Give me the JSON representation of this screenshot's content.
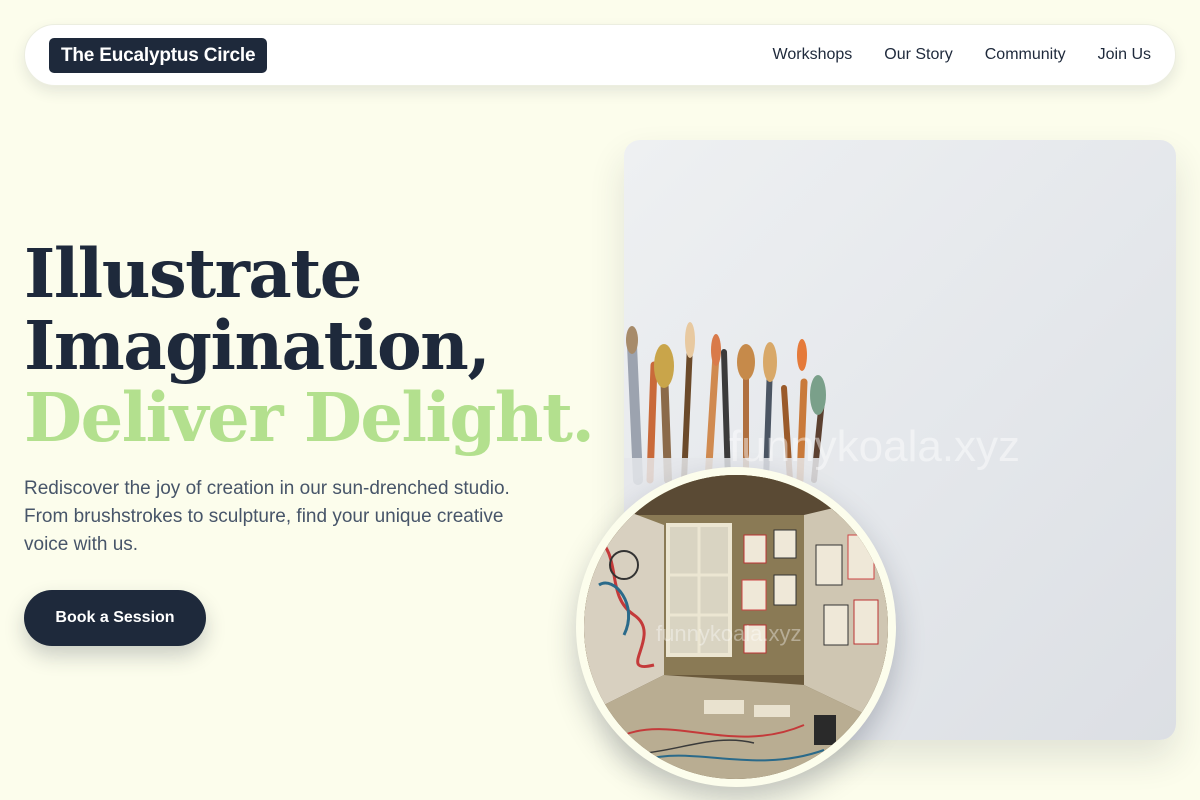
{
  "brand": {
    "name": "The Eucalyptus Circle"
  },
  "nav": {
    "items": [
      {
        "label": "Workshops"
      },
      {
        "label": "Our Story"
      },
      {
        "label": "Community"
      },
      {
        "label": "Join Us"
      }
    ]
  },
  "hero": {
    "headline_line1": "Illustrate",
    "headline_line2": "Imagination,",
    "headline_accent": "Deliver Delight.",
    "description": "Rediscover the joy of creation in our sun-drenched studio. From brushstrokes to sculpture, find your unique creative voice with us.",
    "cta_label": "Book a Session"
  },
  "images": {
    "card_watermark": "funnykoala.xyz",
    "circle_watermark": "funnykoala.xyz"
  },
  "colors": {
    "background": "#fcfdec",
    "primary": "#1e293b",
    "accent": "#b3e08e",
    "text_muted": "#475569"
  }
}
